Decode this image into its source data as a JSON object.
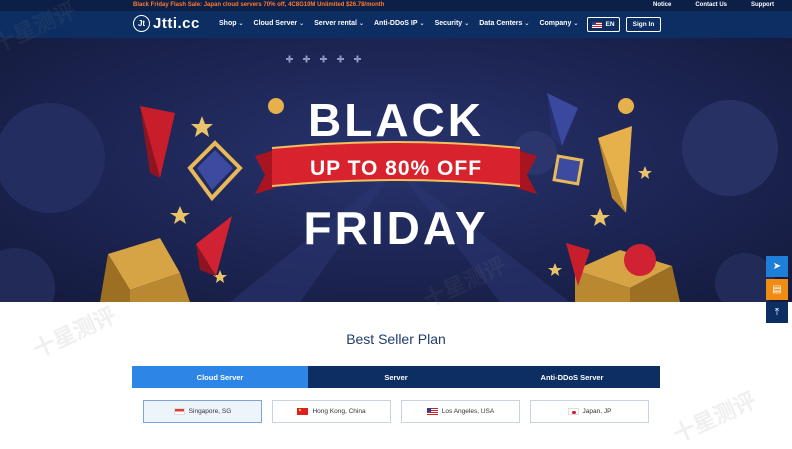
{
  "topbar": {
    "promo": "Black Friday Flash Sale: Japan cloud servers 70% off, 4C8G10M Unlimited $26.78/month",
    "links": [
      "Notice",
      "Contact Us",
      "Support"
    ]
  },
  "nav": {
    "logo_mark": "Jt",
    "logo_text": "Jtti.cc",
    "menu": [
      "Shop",
      "Cloud Server",
      "Server rental",
      "Anti-DDoS IP",
      "Security",
      "Data Centers",
      "Company"
    ],
    "lang": "EN",
    "signin": "Sign In"
  },
  "hero": {
    "line1": "BLACK",
    "ribbon": "UP TO 80% OFF",
    "line2": "FRIDAY"
  },
  "section": {
    "title": "Best Seller Plan"
  },
  "tabs": [
    "Cloud Server",
    "Server",
    "Anti-DDoS Server"
  ],
  "locations": [
    {
      "label": "Singapore, SG",
      "flag": "sg"
    },
    {
      "label": "Hong Kong, China",
      "flag": "cn"
    },
    {
      "label": "Los Angeles, USA",
      "flag": "us"
    },
    {
      "label": "Japan, JP",
      "flag": "jp"
    }
  ],
  "side_tools": [
    "telegram-icon",
    "chat-icon",
    "back-to-top-icon"
  ],
  "watermark": "十星测评",
  "colors": {
    "nav": "#0c2e63",
    "accent": "#2d86e6",
    "promo": "#ff7a2e",
    "ribbon": "#d8222d"
  }
}
